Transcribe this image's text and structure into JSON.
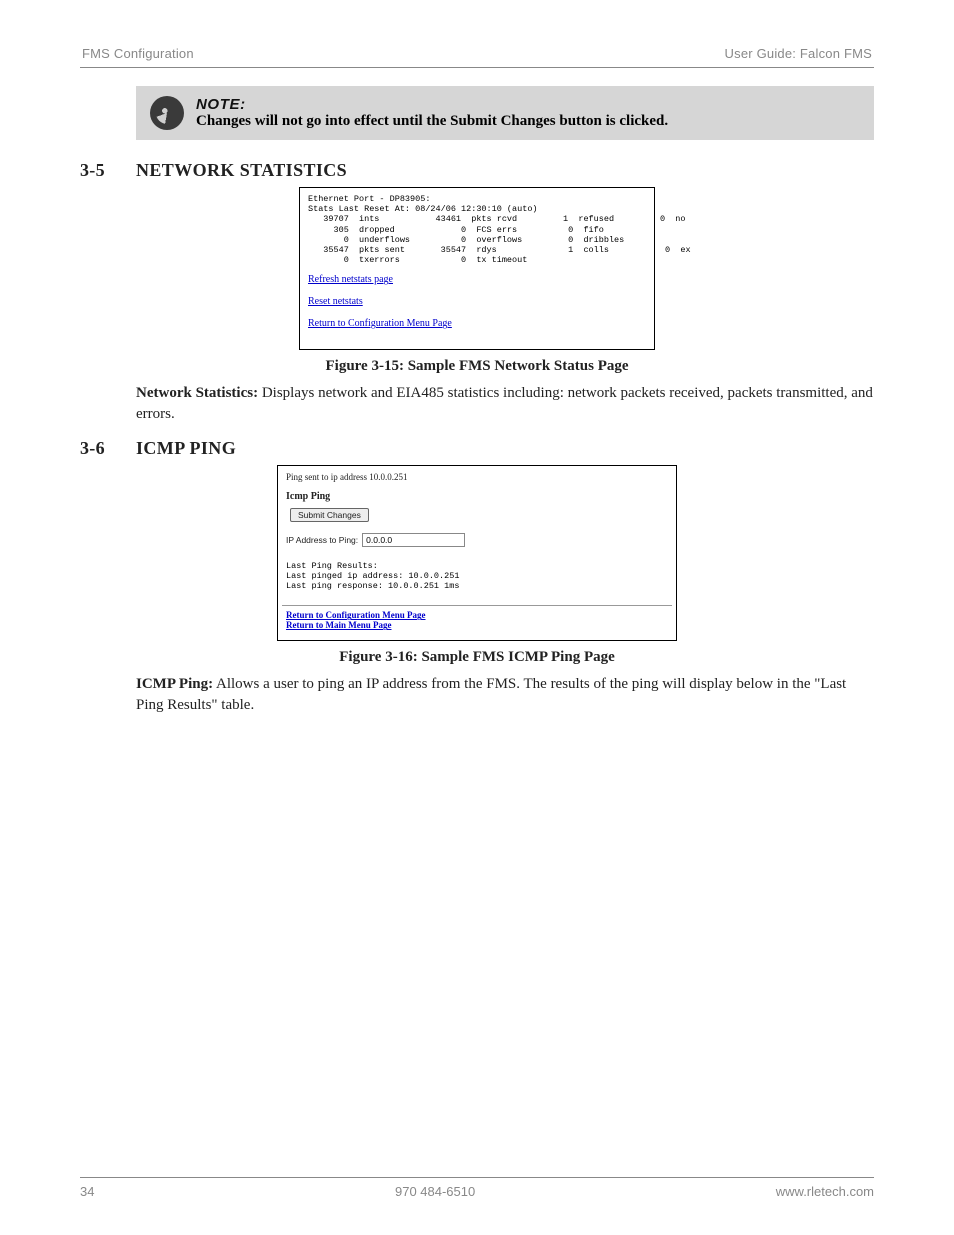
{
  "header": {
    "left": "FMS Configuration",
    "right": "User Guide: Falcon FMS"
  },
  "note": {
    "label": "NOTE:",
    "body": "Changes will not go into effect until the Submit Changes button is clicked."
  },
  "section1": {
    "num": "3-5",
    "title": "NETWORK STATISTICS",
    "fig": {
      "mono_line1": "Ethernet Port - DP83905:",
      "mono_line2": "Stats Last Reset At: 08/24/06 12:30:10 (auto)",
      "row1": "   39707  ints           43461  pkts rcvd         1  refused         0  no",
      "row2": "     305  dropped             0  FCS errs          0  fifo",
      "row3": "       0  underflows          0  overflows         0  dribbles",
      "row4": "   35547  pkts sent       35547  rdys              1  colls           0  ex",
      "row5": "       0  txerrors            0  tx timeout",
      "link_refresh": "Refresh netstats page",
      "link_reset": "Reset netstats",
      "link_return": "Return to Configuration Menu Page",
      "caption": "Figure 3-15: Sample FMS Network Status Page"
    },
    "para_bold": "Network Statistics:",
    "para_rest": " Displays network and EIA485 statistics including: network packets received, packets transmitted, and errors."
  },
  "section2": {
    "num": "3-6",
    "title": "ICMP PING",
    "fig": {
      "top_msg": "Ping sent to ip address 10.0.0.251",
      "head": "Icmp Ping",
      "btn": "Submit Changes",
      "ip_label": "IP Address to Ping:",
      "ip_value": "0.0.0.0",
      "results_l1": "Last Ping Results:",
      "results_l2": "Last pinged ip address: 10.0.0.251",
      "results_l3": "Last ping response: 10.0.0.251 1ms",
      "link_conf": "Return to Configuration Menu Page",
      "link_main": "Return to Main Menu Page",
      "caption": "Figure 3-16: Sample FMS ICMP Ping Page"
    },
    "para_bold": "ICMP Ping:",
    "para_rest": "  Allows a user to ping an IP address from the FMS.  The results of the ping will display below in the \"Last Ping Results\" table."
  },
  "footer": {
    "left": "34",
    "center": "970 484-6510",
    "right": "www.rletech.com"
  }
}
